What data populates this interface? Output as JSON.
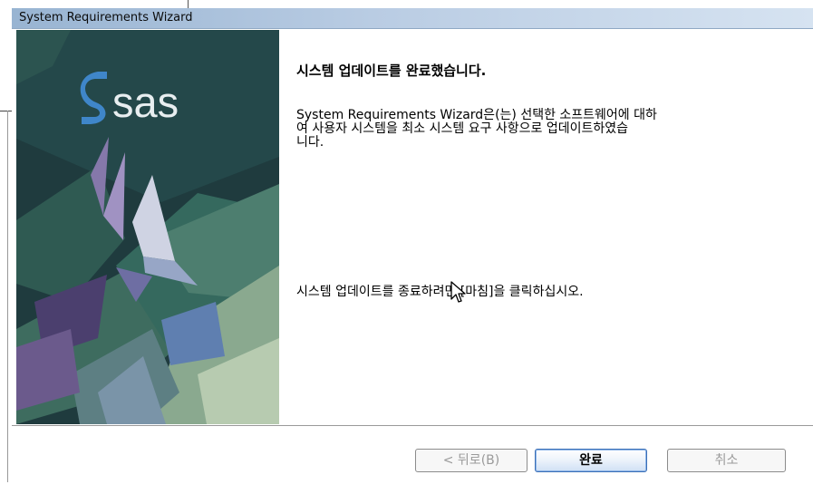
{
  "window": {
    "title": "System Requirements Wizard"
  },
  "banner": {
    "logo_text": "sas"
  },
  "content": {
    "heading": "시스템 업데이트를 완료했습니다.",
    "description_lines": [
      "System Requirements Wizard은(는) 선택한 소프트웨어에 대하",
      "여 사용자 시스템을 최소 시스템 요구 사항으로 업데이트하였습",
      "니다."
    ],
    "finish_instruction": "시스템 업데이트를 종료하려면 [마침]을 클릭하십시오."
  },
  "buttons": {
    "back_label": "< 뒤로(B)",
    "finish_label": "완료",
    "cancel_label": "취소",
    "back_enabled": false,
    "finish_enabled": true,
    "cancel_enabled": false
  },
  "colors": {
    "title_bar": "#b9cce3",
    "banner_bg": "#1f3b3e",
    "logo_blue": "#3f86c9",
    "finish_border": "#3b6fb6",
    "disabled_text": "#9a9a9a"
  },
  "icons": {
    "cursor": "arrow-pointer-icon"
  }
}
